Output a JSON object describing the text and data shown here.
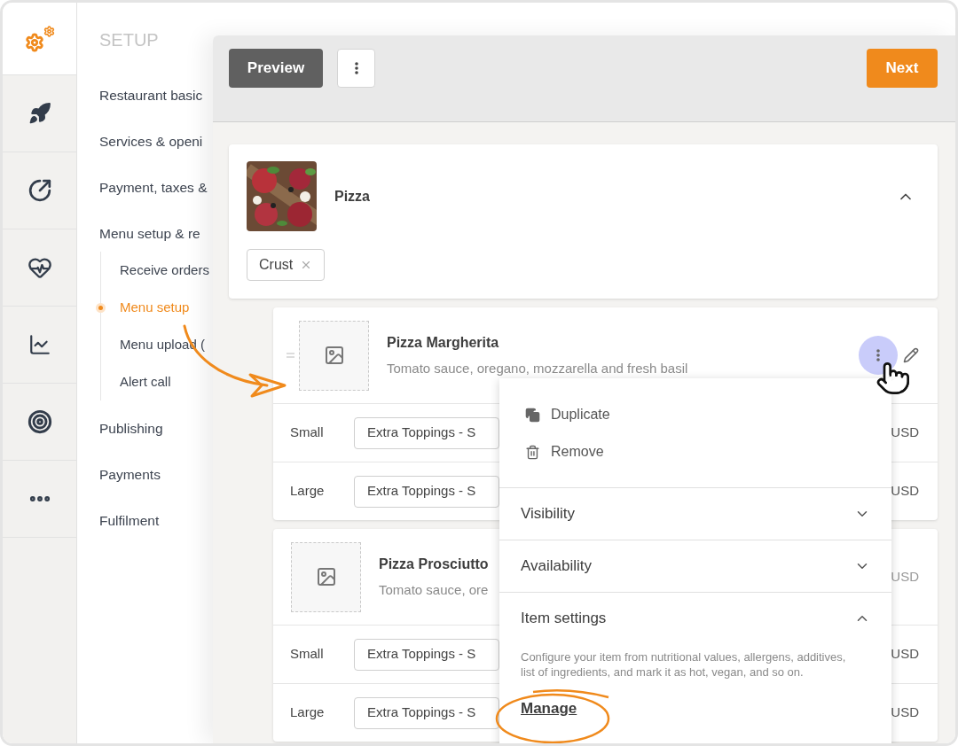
{
  "sidebar": {
    "title": "SETUP",
    "items": [
      {
        "label": "Restaurant basic",
        "selected": false
      },
      {
        "label": "Services & openi",
        "selected": false
      },
      {
        "label": "Payment, taxes &",
        "selected": false
      },
      {
        "label": "Menu setup & re",
        "selected": false,
        "children": [
          {
            "label": "Receive orders",
            "selected": false
          },
          {
            "label": "Menu setup",
            "selected": true
          },
          {
            "label": "Menu upload (",
            "selected": false
          },
          {
            "label": "Alert call",
            "selected": false
          }
        ]
      },
      {
        "label": "Publishing",
        "selected": false
      },
      {
        "label": "Payments",
        "selected": false
      },
      {
        "label": "Fulfilment",
        "selected": false
      }
    ]
  },
  "toolbar": {
    "preview": "Preview",
    "next": "Next"
  },
  "category": {
    "name": "Pizza",
    "expanded": true,
    "tags": [
      "Crust"
    ]
  },
  "items": [
    {
      "name": "Pizza Margherita",
      "description": "Tomato sauce, oregano, mozzarella and fresh basil",
      "menu_open": true,
      "variants": [
        {
          "size": "Small",
          "option": "Extra Toppings - S",
          "currency": "USD"
        },
        {
          "size": "Large",
          "option": "Extra Toppings - S",
          "currency": "USD"
        }
      ]
    },
    {
      "name": "Pizza Prosciutto",
      "description": "Tomato sauce, ore",
      "menu_open": false,
      "currency": "USD",
      "variants": [
        {
          "size": "Small",
          "option": "Extra Toppings - S",
          "currency": "USD"
        },
        {
          "size": "Large",
          "option": "Extra Toppings - S",
          "currency": "USD"
        }
      ]
    }
  ],
  "context_menu": {
    "actions": [
      {
        "label": "Duplicate",
        "kind": "duplicate"
      },
      {
        "label": "Remove",
        "kind": "remove"
      }
    ],
    "sections": [
      {
        "label": "Visibility",
        "expanded": false
      },
      {
        "label": "Availability",
        "expanded": false
      },
      {
        "label": "Item settings",
        "expanded": true,
        "description": "Configure your item from nutritional values, allergens, additives, list of ingredients, and mark it as hot, vegan, and so on.",
        "link": "Manage"
      }
    ]
  }
}
